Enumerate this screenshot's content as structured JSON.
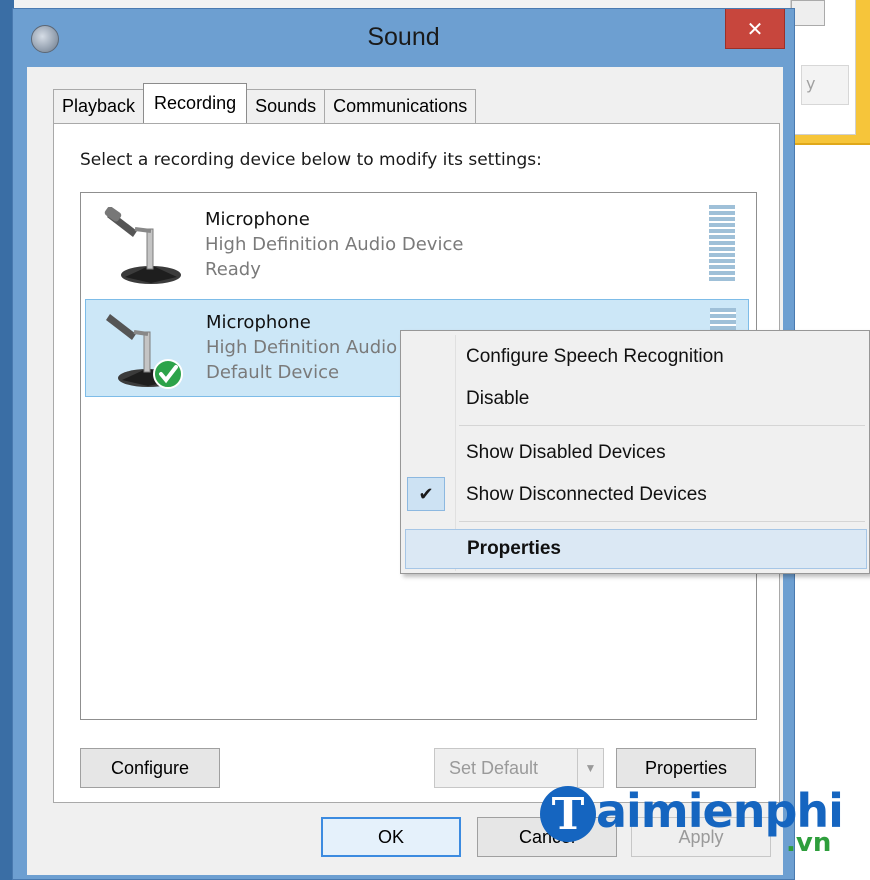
{
  "window": {
    "title": "Sound",
    "close_glyph": "✕"
  },
  "tabs": [
    {
      "label": "Playback"
    },
    {
      "label": "Recording",
      "active": true
    },
    {
      "label": "Sounds"
    },
    {
      "label": "Communications"
    }
  ],
  "instructions": "Select a recording device below to modify its settings:",
  "devices": [
    {
      "name": "Microphone",
      "description": "High Definition Audio Device",
      "status": "Ready",
      "selected": false,
      "icon": "microphone-icon"
    },
    {
      "name": "Microphone",
      "description": "High Definition Audio",
      "status": "Default Device",
      "selected": true,
      "icon": "microphone-default-icon"
    }
  ],
  "context_menu": {
    "items": [
      {
        "label": "Configure Speech Recognition"
      },
      {
        "label": "Disable"
      },
      {
        "label": "Show Disabled Devices"
      },
      {
        "label": "Show Disconnected Devices",
        "checked": true
      },
      {
        "label": "Properties",
        "bold": true,
        "highlighted": true
      }
    ],
    "check_glyph": "✔"
  },
  "buttons": {
    "configure": "Configure",
    "set_default": "Set Default",
    "properties": "Properties",
    "ok": "OK",
    "cancel": "Cancel",
    "apply": "Apply"
  },
  "background_window": {
    "field_text": "y"
  },
  "watermark": {
    "badge": "T",
    "text": "aimienphi",
    "sub": ".vn"
  },
  "colors": {
    "window_frame": "#6d9fd1",
    "close_button": "#c7463d",
    "selection": "#cce7f7",
    "menu_highlight": "#dbe8f4",
    "watermark_blue": "#1565c0",
    "watermark_green": "#2e9e3c"
  }
}
